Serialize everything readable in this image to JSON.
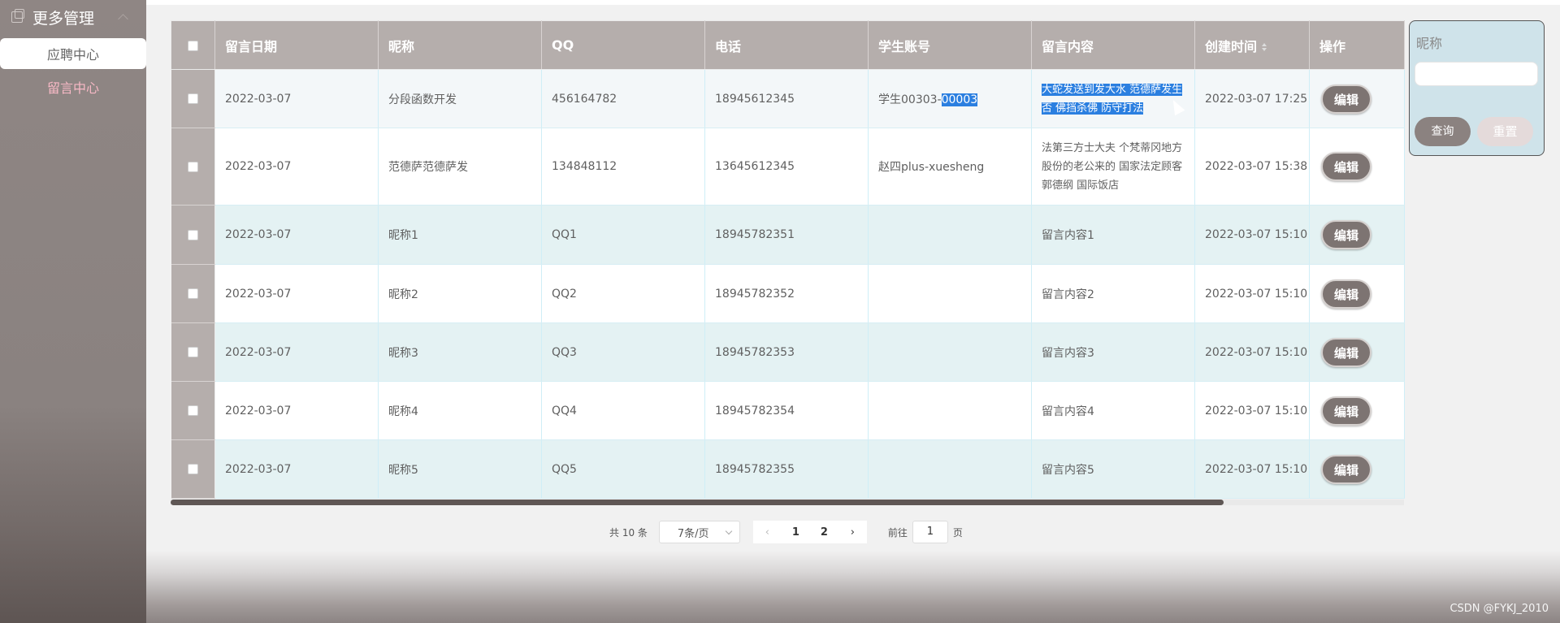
{
  "sidebar": {
    "header": "更多管理",
    "items": [
      {
        "label": "应聘中心"
      },
      {
        "label": "留言中心"
      }
    ]
  },
  "table": {
    "columns": [
      "留言日期",
      "昵称",
      "QQ",
      "电话",
      "学生账号",
      "留言内容",
      "创建时间",
      "操作"
    ],
    "rows": [
      {
        "date": "2022-03-07",
        "nickname": "分段函数开发",
        "qq": "456164782",
        "phone": "18945612345",
        "account_a": "学生00303-",
        "account_b": "00003",
        "content": "大蛇发送到发大水 范德萨发生否 佛挡杀佛 防守打法",
        "created": "2022-03-07 17:25",
        "op": "编辑"
      },
      {
        "date": "2022-03-07",
        "nickname": "范德萨范德萨发",
        "qq": "134848112",
        "phone": "13645612345",
        "account": "赵四plus-xuesheng",
        "content": "法第三方士大夫 个梵蒂冈地方 股份的老公来的 国家法定顾客 郭德纲 国际饭店",
        "created": "2022-03-07 15:38",
        "op": "编辑"
      },
      {
        "date": "2022-03-07",
        "nickname": "昵称1",
        "qq": "QQ1",
        "phone": "18945782351",
        "account": "",
        "content": "留言内容1",
        "created": "2022-03-07 15:10",
        "op": "编辑"
      },
      {
        "date": "2022-03-07",
        "nickname": "昵称2",
        "qq": "QQ2",
        "phone": "18945782352",
        "account": "",
        "content": "留言内容2",
        "created": "2022-03-07 15:10",
        "op": "编辑"
      },
      {
        "date": "2022-03-07",
        "nickname": "昵称3",
        "qq": "QQ3",
        "phone": "18945782353",
        "account": "",
        "content": "留言内容3",
        "created": "2022-03-07 15:10",
        "op": "编辑"
      },
      {
        "date": "2022-03-07",
        "nickname": "昵称4",
        "qq": "QQ4",
        "phone": "18945782354",
        "account": "",
        "content": "留言内容4",
        "created": "2022-03-07 15:10",
        "op": "编辑"
      },
      {
        "date": "2022-03-07",
        "nickname": "昵称5",
        "qq": "QQ5",
        "phone": "18945782355",
        "account": "",
        "content": "留言内容5",
        "created": "2022-03-07 15:10",
        "op": "编辑"
      }
    ]
  },
  "search": {
    "label": "昵称",
    "query_label": "查询",
    "reset_label": "重置"
  },
  "pagination": {
    "total": "共 10 条",
    "page_size": "7条/页",
    "pages": [
      "1",
      "2"
    ],
    "goto_prefix": "前往",
    "goto_value": "1",
    "goto_suffix": "页"
  },
  "watermark": "CSDN @FYKJ_2010"
}
